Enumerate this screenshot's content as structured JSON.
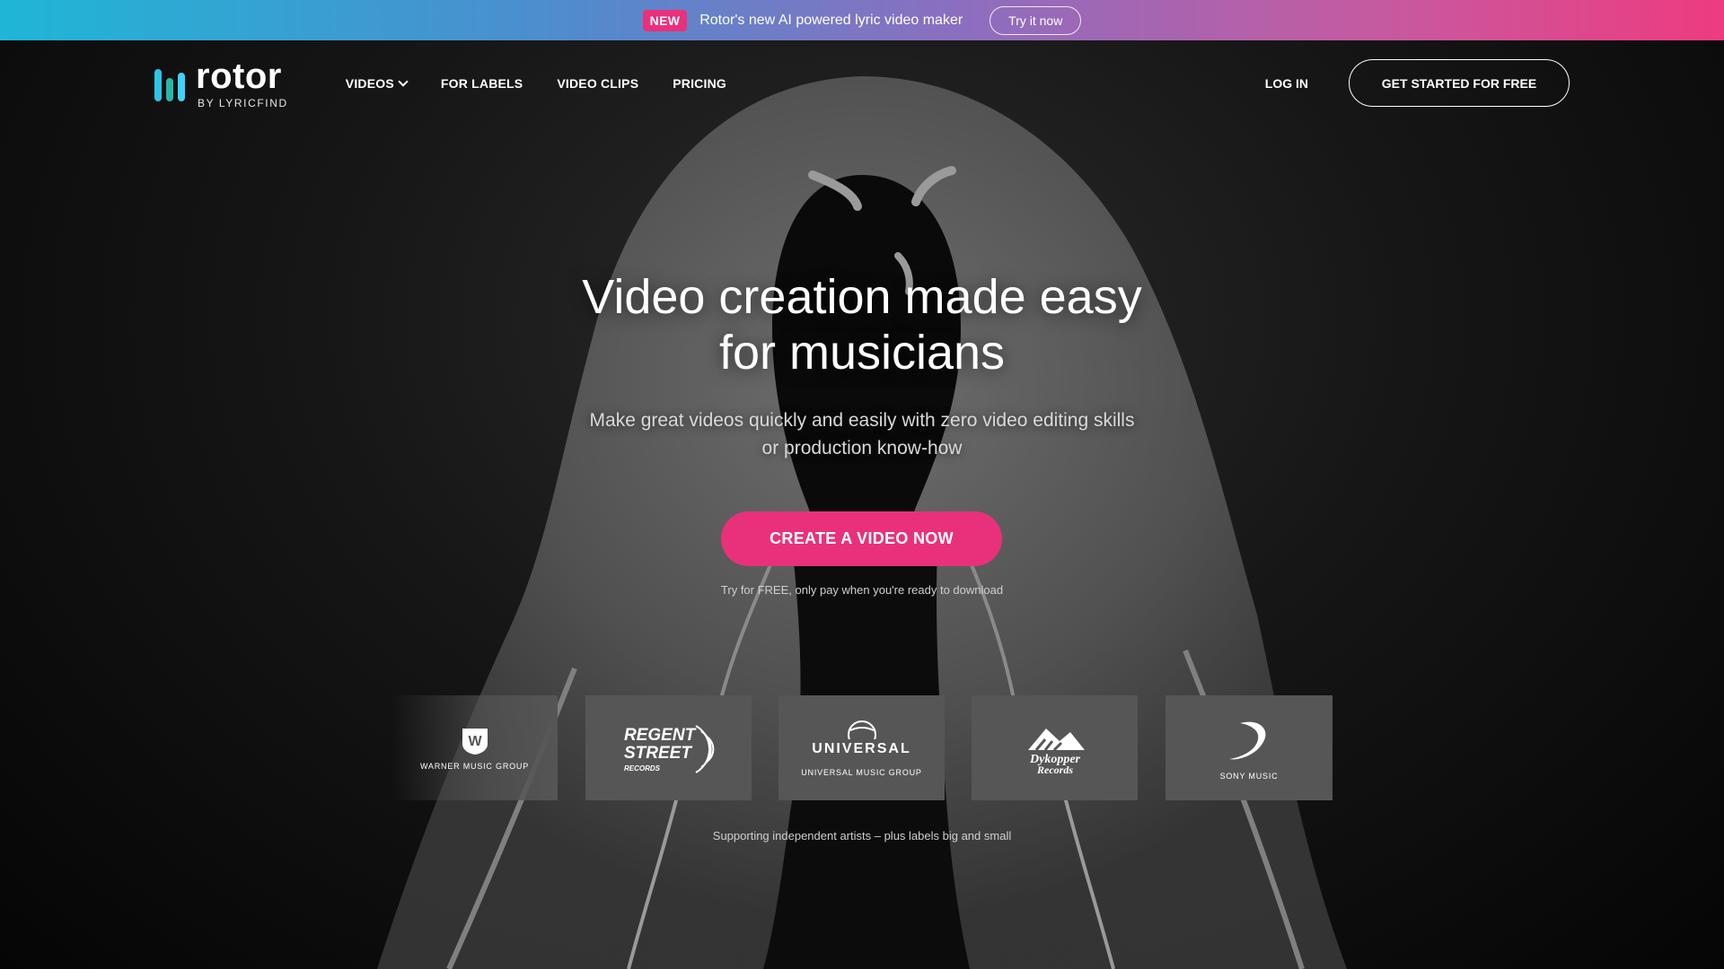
{
  "promo": {
    "badge": "NEW",
    "text": "Rotor's new AI powered lyric video maker",
    "button": "Try it now"
  },
  "header": {
    "logo_name": "rotor",
    "logo_sub": "BY LYRICFIND",
    "logo_colors": [
      "#2ec4e6",
      "#27b8a8",
      "#3fd1ff"
    ],
    "nav": [
      {
        "label": "VIDEOS",
        "has_dropdown": true
      },
      {
        "label": "FOR LABELS"
      },
      {
        "label": "VIDEO CLIPS"
      },
      {
        "label": "PRICING"
      }
    ],
    "login": "LOG IN",
    "get_started": "GET STARTED FOR FREE"
  },
  "hero": {
    "title_line1": "Video creation made easy",
    "title_line2": "for musicians",
    "subtitle_line1": "Make great videos quickly and easily with zero video editing skills",
    "subtitle_line2": "or production know-how",
    "cta": "CREATE A VIDEO NOW",
    "hint": "Try for FREE, only pay when you're ready to download",
    "accent_color": "#e8317a"
  },
  "labels": {
    "items": [
      {
        "name": "WARNER MUSIC GROUP"
      },
      {
        "name": "REGENT STREET RECORDS"
      },
      {
        "name": "UNIVERSAL",
        "sub": "UNIVERSAL MUSIC GROUP"
      },
      {
        "name": "Dykopper Records"
      },
      {
        "name": "SONY MUSIC"
      }
    ],
    "support_text": "Supporting independent artists – plus labels big and small"
  }
}
